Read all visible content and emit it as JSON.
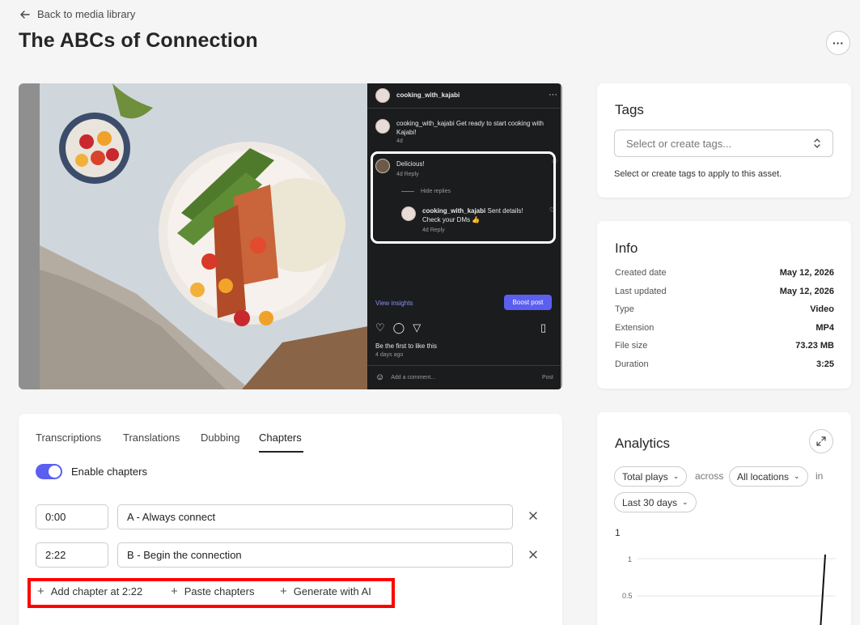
{
  "header": {
    "back_label": "Back to media library",
    "title": "The ABCs of Connection",
    "more_label": "···"
  },
  "preview": {
    "username": "cooking_with_kajabi",
    "caption_user": "cooking_with_kajabi",
    "caption_text": "Get ready to start cooking with Kajabi!",
    "caption_time": "4d",
    "comment_text": "Delicious!",
    "comment_meta": "4d   Reply",
    "hide_replies": "Hide replies",
    "reply_user": "cooking_with_kajabi",
    "reply_text": "Sent details! Check your DMs 👍",
    "reply_meta": "4d   Reply",
    "view_insights": "View insights",
    "boost_label": "Boost post",
    "likes_text": "Be the first to like this",
    "likes_time": "4 days ago",
    "comment_placeholder": "Add a comment...",
    "post_label": "Post"
  },
  "tags": {
    "title": "Tags",
    "placeholder": "Select or create tags...",
    "help": "Select or create tags to apply to this asset."
  },
  "info": {
    "title": "Info",
    "rows": [
      {
        "label": "Created date",
        "value": "May 12, 2026"
      },
      {
        "label": "Last updated",
        "value": "May 12, 2026"
      },
      {
        "label": "Type",
        "value": "Video"
      },
      {
        "label": "Extension",
        "value": "MP4"
      },
      {
        "label": "File size",
        "value": "73.23 MB"
      },
      {
        "label": "Duration",
        "value": "3:25"
      }
    ]
  },
  "tabs": [
    {
      "label": "Transcriptions"
    },
    {
      "label": "Translations"
    },
    {
      "label": "Dubbing"
    },
    {
      "label": "Chapters",
      "active": true
    }
  ],
  "chapters": {
    "enable_label": "Enable chapters",
    "enabled": true,
    "items": [
      {
        "time": "0:00",
        "title": "A - Always connect"
      },
      {
        "time": "2:22",
        "title": "B - Begin the connection"
      }
    ],
    "actions": {
      "add": "Add chapter at 2:22",
      "paste": "Paste chapters",
      "generate": "Generate with AI"
    }
  },
  "analytics": {
    "title": "Analytics",
    "metric": "Total plays",
    "across": "across",
    "location": "All locations",
    "in": "in",
    "period": "Last 30 days",
    "max_label": "1",
    "tick_top": "1",
    "tick_mid": "0.5"
  },
  "colors": {
    "accent": "#5b5ff0",
    "highlight": "#ff0000"
  }
}
